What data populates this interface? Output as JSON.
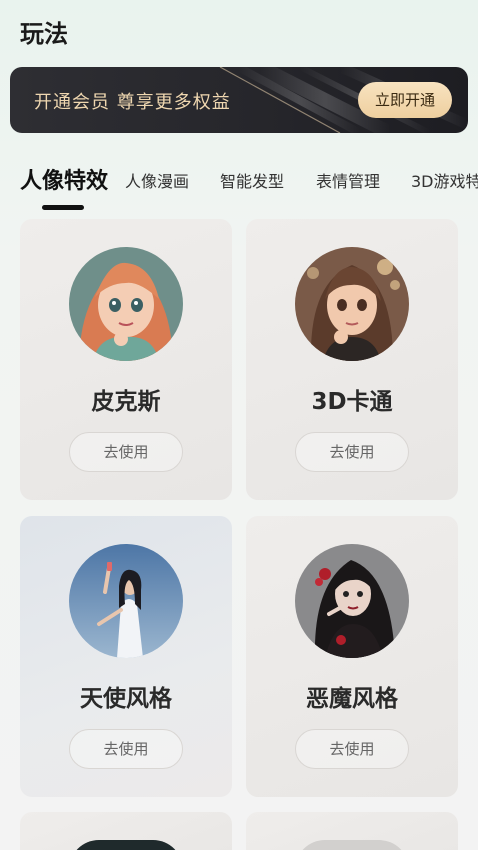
{
  "page": {
    "title": "玩法"
  },
  "vip_banner": {
    "text": "开通会员 尊享更多权益",
    "button_label": "立即开通"
  },
  "tabs": [
    {
      "label": "人像特效",
      "active": true
    },
    {
      "label": "人像漫画",
      "active": false
    },
    {
      "label": "智能发型",
      "active": false
    },
    {
      "label": "表情管理",
      "active": false
    },
    {
      "label": "3D游戏特",
      "active": false
    }
  ],
  "cards": [
    {
      "name": "皮克斯",
      "button_label": "去使用",
      "avatar": "pixar-girl-portrait"
    },
    {
      "name": "3D卡通",
      "button_label": "去使用",
      "avatar": "3d-cartoon-girl-portrait"
    },
    {
      "name": "天使风格",
      "button_label": "去使用",
      "avatar": "angel-style-girl-photo"
    },
    {
      "name": "恶魔风格",
      "button_label": "去使用",
      "avatar": "devil-style-girl-photo"
    }
  ],
  "colors": {
    "vip_text": "#efd7b0",
    "vip_button": "#f3d9ae",
    "active_tab_indicator": "#111111"
  }
}
